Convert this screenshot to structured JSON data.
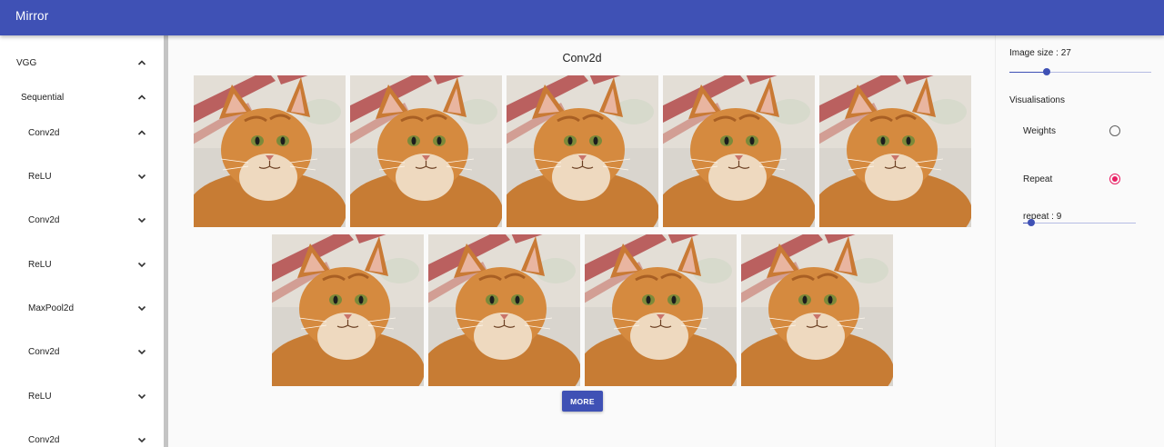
{
  "app": {
    "title": "Mirror"
  },
  "tree": [
    {
      "label": "VGG",
      "expanded": true,
      "depth": 0
    },
    {
      "label": "Sequential",
      "expanded": true,
      "depth": 1
    },
    {
      "label": "Conv2d",
      "expanded": true,
      "depth": 2
    },
    {
      "label": "ReLU",
      "expanded": false,
      "depth": 2
    },
    {
      "label": "Conv2d",
      "expanded": false,
      "depth": 2
    },
    {
      "label": "ReLU",
      "expanded": false,
      "depth": 2
    },
    {
      "label": "MaxPool2d",
      "expanded": false,
      "depth": 2
    },
    {
      "label": "Conv2d",
      "expanded": false,
      "depth": 2
    },
    {
      "label": "ReLU",
      "expanded": false,
      "depth": 2
    },
    {
      "label": "Conv2d",
      "expanded": false,
      "depth": 2
    }
  ],
  "main": {
    "layer_title": "Conv2d",
    "image_count": 9,
    "more_label": "MORE"
  },
  "settings": {
    "image_size_label": "Image size : 27",
    "image_size_level": 0.26,
    "visualisations_label": "Visualisations",
    "options": [
      {
        "label": "Weights",
        "checked": false
      },
      {
        "label": "Repeat",
        "checked": true
      }
    ],
    "repeat_label": "repeat : 9",
    "repeat_level": 0.07
  },
  "colors": {
    "primary": "#3f51b5",
    "accent": "#e91e63"
  }
}
